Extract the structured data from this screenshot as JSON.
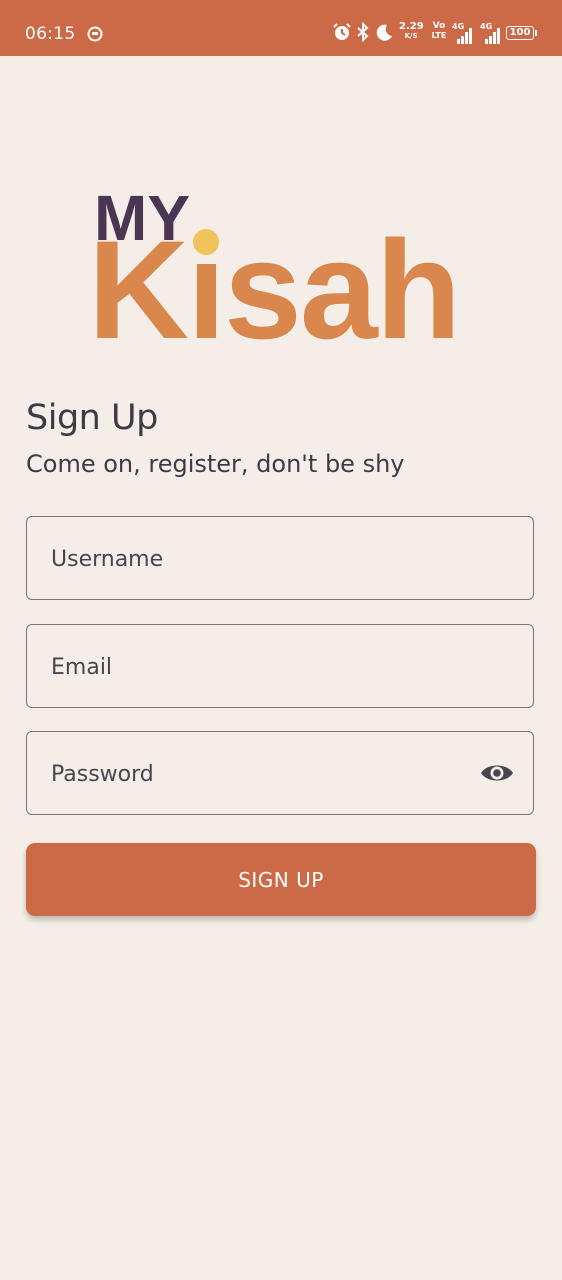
{
  "status_bar": {
    "time": "06:15",
    "net_speed_value": "2.29",
    "net_speed_unit": "K/S",
    "volte_top": "Vo",
    "volte_bottom": "LTE",
    "signal1_label": "4G",
    "signal2_label": "4G",
    "battery": "100"
  },
  "logo": {
    "line1": "MY",
    "line2": "Kisah",
    "colors": {
      "line1": "#4a3552",
      "line2": "#d9874c",
      "dot": "#f0c35c"
    }
  },
  "header": {
    "title": "Sign Up",
    "subtitle": "Come on, register, don't be shy"
  },
  "form": {
    "username_placeholder": "Username",
    "email_placeholder": "Email",
    "password_placeholder": "Password",
    "toggle_visibility_icon": "eye-icon",
    "submit_label": "SIGN UP"
  },
  "colors": {
    "accent": "#cc6a48",
    "background": "#f5eee8",
    "text": "#3f3a45"
  }
}
